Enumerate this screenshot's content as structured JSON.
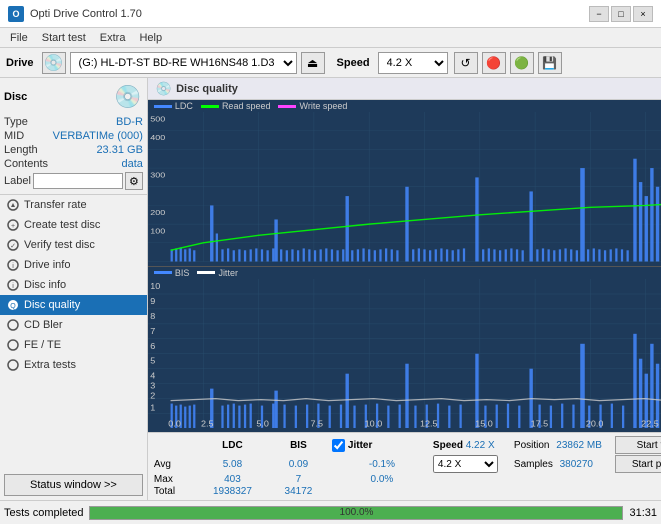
{
  "app": {
    "title": "Opti Drive Control 1.70",
    "icon": "O"
  },
  "titlebar": {
    "minimize": "−",
    "maximize": "□",
    "close": "×"
  },
  "menubar": {
    "items": [
      "File",
      "Start test",
      "Extra",
      "Help"
    ]
  },
  "toolbar": {
    "drive_label": "Drive",
    "drive_value": "(G:)  HL-DT-ST BD-RE  WH16NS48 1.D3",
    "speed_label": "Speed",
    "speed_value": "4.2 X"
  },
  "disc": {
    "title": "Disc",
    "type_label": "Type",
    "type_value": "BD-R",
    "mid_label": "MID",
    "mid_value": "VERBATIMe (000)",
    "length_label": "Length",
    "length_value": "23.31 GB",
    "contents_label": "Contents",
    "contents_value": "data",
    "label_label": "Label",
    "label_placeholder": ""
  },
  "nav": {
    "items": [
      {
        "id": "transfer-rate",
        "label": "Transfer rate",
        "active": false
      },
      {
        "id": "create-test-disc",
        "label": "Create test disc",
        "active": false
      },
      {
        "id": "verify-test-disc",
        "label": "Verify test disc",
        "active": false
      },
      {
        "id": "drive-info",
        "label": "Drive info",
        "active": false
      },
      {
        "id": "disc-info",
        "label": "Disc info",
        "active": false
      },
      {
        "id": "disc-quality",
        "label": "Disc quality",
        "active": true
      },
      {
        "id": "cd-bler",
        "label": "CD Bler",
        "active": false
      },
      {
        "id": "fe-te",
        "label": "FE / TE",
        "active": false
      },
      {
        "id": "extra-tests",
        "label": "Extra tests",
        "active": false
      }
    ]
  },
  "status_window_btn": "Status window >>",
  "quality_panel": {
    "title": "Disc quality",
    "icon": "💿",
    "legend": {
      "ldc_label": "LDC",
      "read_label": "Read speed",
      "write_label": "Write speed",
      "bis_label": "BIS",
      "jitter_label": "Jitter"
    }
  },
  "stats": {
    "headers": [
      "",
      "LDC",
      "BIS",
      "",
      "Jitter",
      "Speed",
      ""
    ],
    "avg_label": "Avg",
    "avg_ldc": "5.08",
    "avg_bis": "0.09",
    "avg_jitter": "-0.1%",
    "max_label": "Max",
    "max_ldc": "403",
    "max_bis": "7",
    "max_jitter": "0.0%",
    "total_label": "Total",
    "total_ldc": "1938327",
    "total_bis": "34172",
    "speed_label": "Speed",
    "speed_value": "4.22 X",
    "position_label": "Position",
    "position_value": "23862 MB",
    "samples_label": "Samples",
    "samples_value": "380270",
    "jitter_checked": true,
    "jitter_label": "Jitter",
    "speed_select": "4.2 X"
  },
  "buttons": {
    "start_full": "Start full",
    "start_part": "Start part"
  },
  "footer": {
    "status": "Tests completed",
    "progress": "100.0%",
    "time": "31:31"
  },
  "colors": {
    "ldc": "#0080ff",
    "read_speed": "#00ff00",
    "write_speed": "#ff00ff",
    "bis": "#0080ff",
    "jitter": "#ffffff",
    "chart_bg": "#1a3050",
    "grid": "#2a4a6a",
    "accent": "#1a6fb5"
  }
}
